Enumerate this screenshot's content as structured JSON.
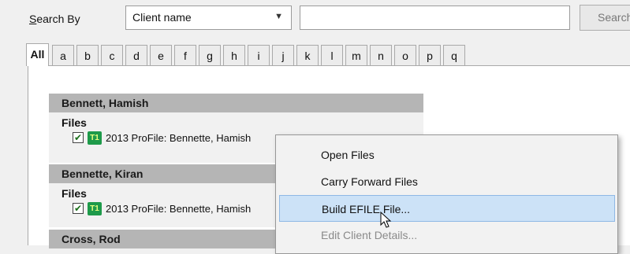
{
  "search": {
    "label_accel": "S",
    "label_rest": "earch By",
    "by_value": "Client name",
    "query": "",
    "button_label": "Search"
  },
  "tabs": [
    "All",
    "a",
    "b",
    "c",
    "d",
    "e",
    "f",
    "g",
    "h",
    "i",
    "j",
    "k",
    "l",
    "m",
    "n",
    "o",
    "p",
    "q"
  ],
  "clients": [
    {
      "name": "Bennett, Hamish",
      "files_label": "Files",
      "file_badge": "T1",
      "file_text": "2013 ProFile: Bennette, Hamish"
    },
    {
      "name": "Bennette, Kiran",
      "files_label": "Files",
      "file_badge": "T1",
      "file_text": "2013 ProFile: Bennette, Hamish"
    },
    {
      "name": "Cross, Rod"
    }
  ],
  "context_menu": {
    "items": [
      "Open Files",
      "Carry Forward Files",
      "Build EFILE File...",
      "Edit Client Details..."
    ]
  },
  "colors": {
    "highlight": "#cce2f7",
    "badge": "#1e9a4a"
  }
}
